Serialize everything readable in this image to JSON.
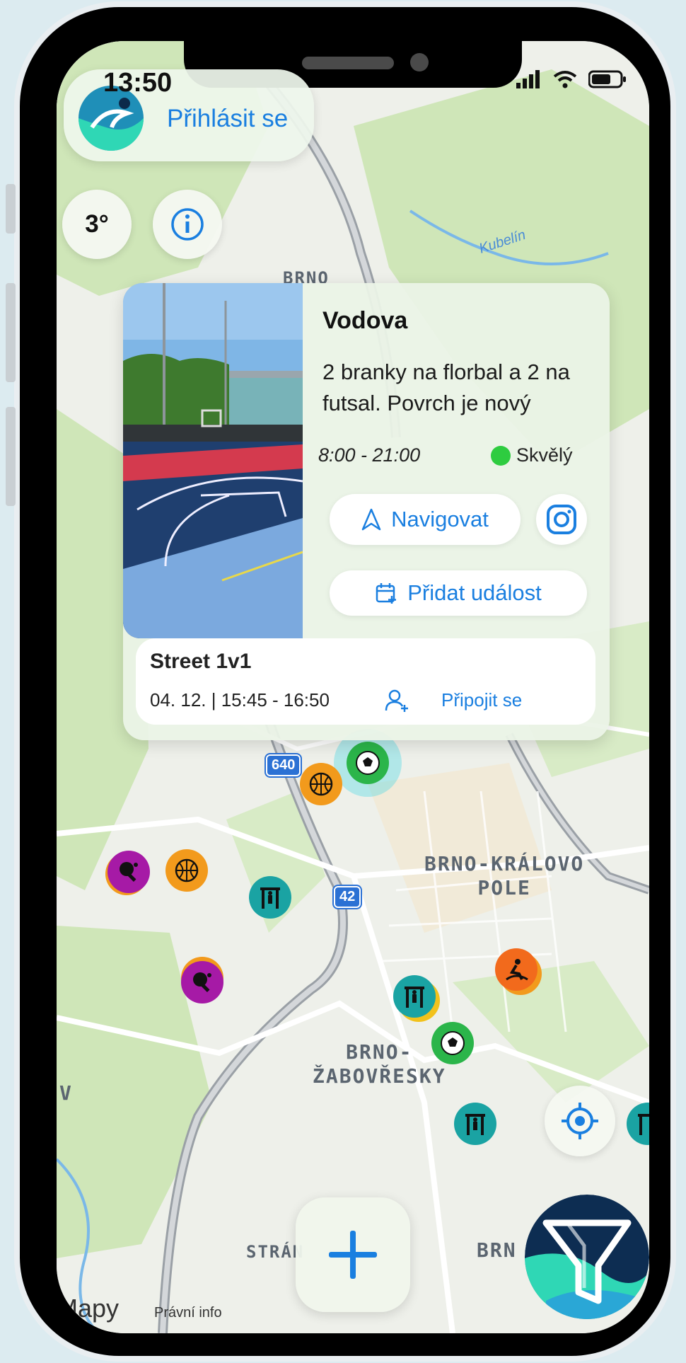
{
  "status_bar": {
    "time": "13:50"
  },
  "header": {
    "login_label": "Přihlásit se"
  },
  "weather": {
    "temperature": "3°"
  },
  "spot_card": {
    "name": "Vodova",
    "description": "2 branky na florbal a 2 na futsal. Povrch je nový",
    "hours": "8:00 - 21:00",
    "condition": "Skvělý",
    "condition_color": "#2ecc40",
    "navigate_label": "Navigovat",
    "add_event_label": "Přidat událost",
    "event": {
      "title": "Street 1v1",
      "datetime": "04. 12. | 15:45 - 16:50",
      "join_label": "Připojit se"
    }
  },
  "map": {
    "labels": {
      "kubelin": "Kubelín",
      "brno_top": "BRNO",
      "kralovo_pole_line1": "BRNO-KRÁLOVO",
      "kralovo_pole_line2": "POLE",
      "zabovresky_line1": "BRNO-",
      "zabovresky_line2": "ŽABOVŘESKY",
      "stran": "STRÁN",
      "brn": "BRN",
      "v": "V"
    },
    "road_badges": [
      "640",
      "42"
    ],
    "markers": [
      {
        "type": "football-icon",
        "color": "#2bb54a"
      },
      {
        "type": "basketball-icon",
        "color": "#f29a1c"
      },
      {
        "type": "table-tennis-icon",
        "color": "#a61aa6"
      },
      {
        "type": "basketball-icon",
        "color": "#f29a1c"
      },
      {
        "type": "workout-icon",
        "color": "#1aa3a3"
      },
      {
        "type": "table-tennis-icon",
        "color": "#a61aa6"
      },
      {
        "type": "workout-icon",
        "color": "#1aa3a3"
      },
      {
        "type": "football-icon",
        "color": "#2bb54a"
      },
      {
        "type": "skate-icon",
        "color": "#f26a1c"
      },
      {
        "type": "workout-icon",
        "color": "#1aa3a3"
      }
    ]
  },
  "footer": {
    "maps_brand": "Mapy",
    "legal_label": "Právní info"
  },
  "colors": {
    "accent": "#1a7fe0",
    "map_bg": "#eef0ea",
    "park": "#cfe6b8"
  }
}
